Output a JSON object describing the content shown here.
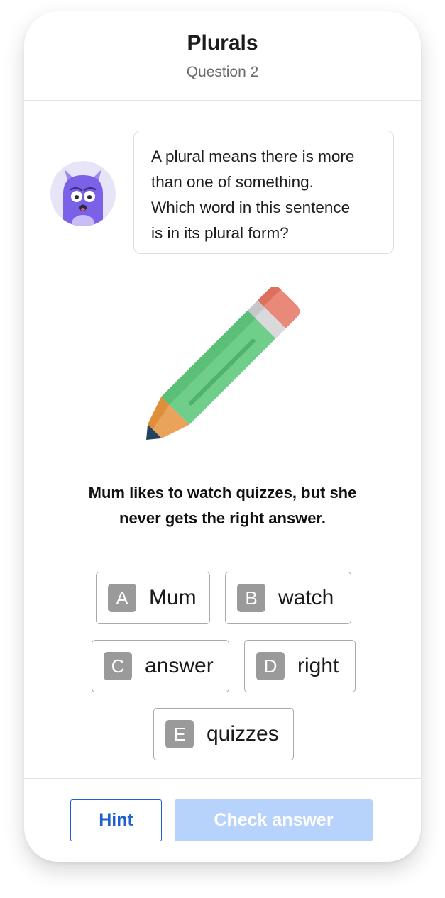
{
  "header": {
    "title": "Plurals",
    "subtitle": "Question 2"
  },
  "prompt": {
    "lines": [
      "A plural means there is more",
      "than one of something.",
      "Which word in this sentence",
      "is in its plural form?"
    ]
  },
  "illustration": {
    "icon": "pencil-icon",
    "avatar_icon": "monster-avatar-icon"
  },
  "question": {
    "sentence_lines": [
      "Mum likes to watch quizzes, but she",
      "never gets the right answer."
    ]
  },
  "options": [
    {
      "letter": "A",
      "label": "Mum"
    },
    {
      "letter": "B",
      "label": "watch"
    },
    {
      "letter": "C",
      "label": "answer"
    },
    {
      "letter": "D",
      "label": "right"
    },
    {
      "letter": "E",
      "label": "quizzes"
    }
  ],
  "footer": {
    "hint_label": "Hint",
    "check_label": "Check answer"
  },
  "colors": {
    "accent": "#1f5fd0",
    "check_disabled": "#b7d3fb",
    "avatar_purple": "#7b61e8",
    "option_letter_bg": "#9a9a9a"
  }
}
